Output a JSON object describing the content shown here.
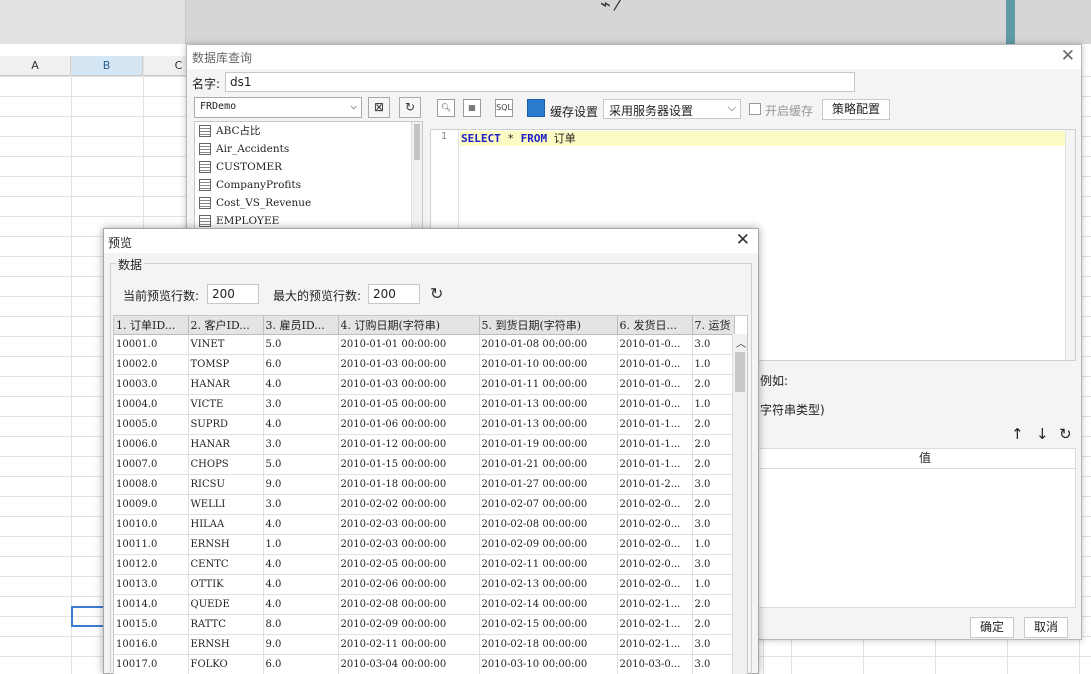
{
  "spreadsheet": {
    "columns": [
      "A",
      "B",
      "C"
    ]
  },
  "query_dialog": {
    "title": "数据库查询",
    "name_label": "名字:",
    "name_value": "ds1",
    "datasource": "FRDemo",
    "tables": [
      "ABC占比",
      "Air_Accidents",
      "CUSTOMER",
      "CompanyProfits",
      "Cost_VS_Revenue",
      "EMPLOYEE"
    ],
    "cache_label": "缓存设置",
    "cache_option": "采用服务器设置",
    "enable_cache_label": "开启缓存",
    "policy_button": "策略配置",
    "line_number": "1",
    "sql": {
      "kw_select": "SELECT",
      "star": " * ",
      "kw_from": "FROM",
      "table": " 订单"
    },
    "param_hint_1": "例如:",
    "param_hint_2": "字符串类型)",
    "param_value_header": "值",
    "ok_button": "确定",
    "cancel_button": "取消"
  },
  "preview_dialog": {
    "title": "预览",
    "group_label": "数据",
    "current_rows_label": "当前预览行数:",
    "current_rows_value": "200",
    "max_rows_label": "最大的预览行数:",
    "max_rows_value": "200",
    "columns": [
      "1. 订单ID...",
      "2. 客户ID...",
      "3. 雇员ID...",
      "4. 订购日期(字符串)",
      "5. 到货日期(字符串)",
      "6. 发货日...",
      "7. 运货"
    ],
    "rows": [
      [
        "10001.0",
        "VINET",
        "5.0",
        "2010-01-01 00:00:00",
        "2010-01-08 00:00:00",
        "2010-01-0...",
        "3.0"
      ],
      [
        "10002.0",
        "TOMSP",
        "6.0",
        "2010-01-03 00:00:00",
        "2010-01-10 00:00:00",
        "2010-01-0...",
        "1.0"
      ],
      [
        "10003.0",
        "HANAR",
        "4.0",
        "2010-01-03 00:00:00",
        "2010-01-11 00:00:00",
        "2010-01-0...",
        "2.0"
      ],
      [
        "10004.0",
        "VICTE",
        "3.0",
        "2010-01-05 00:00:00",
        "2010-01-13 00:00:00",
        "2010-01-0...",
        "1.0"
      ],
      [
        "10005.0",
        "SUPRD",
        "4.0",
        "2010-01-06 00:00:00",
        "2010-01-13 00:00:00",
        "2010-01-1...",
        "2.0"
      ],
      [
        "10006.0",
        "HANAR",
        "3.0",
        "2010-01-12 00:00:00",
        "2010-01-19 00:00:00",
        "2010-01-1...",
        "2.0"
      ],
      [
        "10007.0",
        "CHOPS",
        "5.0",
        "2010-01-15 00:00:00",
        "2010-01-21 00:00:00",
        "2010-01-1...",
        "2.0"
      ],
      [
        "10008.0",
        "RICSU",
        "9.0",
        "2010-01-18 00:00:00",
        "2010-01-27 00:00:00",
        "2010-01-2...",
        "3.0"
      ],
      [
        "10009.0",
        "WELLI",
        "3.0",
        "2010-02-02 00:00:00",
        "2010-02-07 00:00:00",
        "2010-02-0...",
        "2.0"
      ],
      [
        "10010.0",
        "HILAA",
        "4.0",
        "2010-02-03 00:00:00",
        "2010-02-08 00:00:00",
        "2010-02-0...",
        "3.0"
      ],
      [
        "10011.0",
        "ERNSH",
        "1.0",
        "2010-02-03 00:00:00",
        "2010-02-09 00:00:00",
        "2010-02-0...",
        "1.0"
      ],
      [
        "10012.0",
        "CENTC",
        "4.0",
        "2010-02-05 00:00:00",
        "2010-02-11 00:00:00",
        "2010-02-0...",
        "3.0"
      ],
      [
        "10013.0",
        "OTTIK",
        "4.0",
        "2010-02-06 00:00:00",
        "2010-02-13 00:00:00",
        "2010-02-0...",
        "1.0"
      ],
      [
        "10014.0",
        "QUEDE",
        "4.0",
        "2010-02-08 00:00:00",
        "2010-02-14 00:00:00",
        "2010-02-1...",
        "2.0"
      ],
      [
        "10015.0",
        "RATTC",
        "8.0",
        "2010-02-09 00:00:00",
        "2010-02-15 00:00:00",
        "2010-02-1...",
        "2.0"
      ],
      [
        "10016.0",
        "ERNSH",
        "9.0",
        "2010-02-11 00:00:00",
        "2010-02-18 00:00:00",
        "2010-02-1...",
        "3.0"
      ],
      [
        "10017.0",
        "FOLKO",
        "6.0",
        "2010-03-04 00:00:00",
        "2010-03-10 00:00:00",
        "2010-03-0...",
        "3.0"
      ]
    ]
  }
}
